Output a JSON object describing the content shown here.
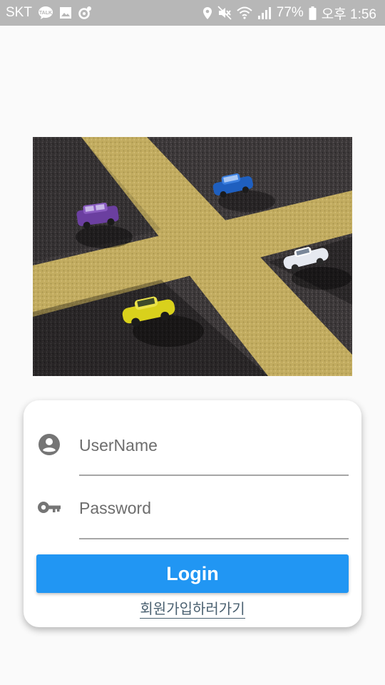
{
  "status_bar": {
    "carrier": "SKT",
    "battery": "77%",
    "time": "오후 1:56",
    "icons_left": [
      "talk-icon",
      "gallery-icon",
      "sync-icon"
    ],
    "icons_right": [
      "location-icon",
      "mute-icon",
      "wifi-icon",
      "signal-icon",
      "battery-icon"
    ]
  },
  "hero_image": {
    "description": "toy-cars-on-road-crossing"
  },
  "login_form": {
    "username_placeholder": "UserName",
    "password_placeholder": "Password",
    "login_label": "Login",
    "signup_link": "회원가입하러가기"
  },
  "colors": {
    "primary": "#2196f3",
    "status_bar": "#b7b7b7",
    "background": "#fafafa",
    "icon": "#757575"
  }
}
